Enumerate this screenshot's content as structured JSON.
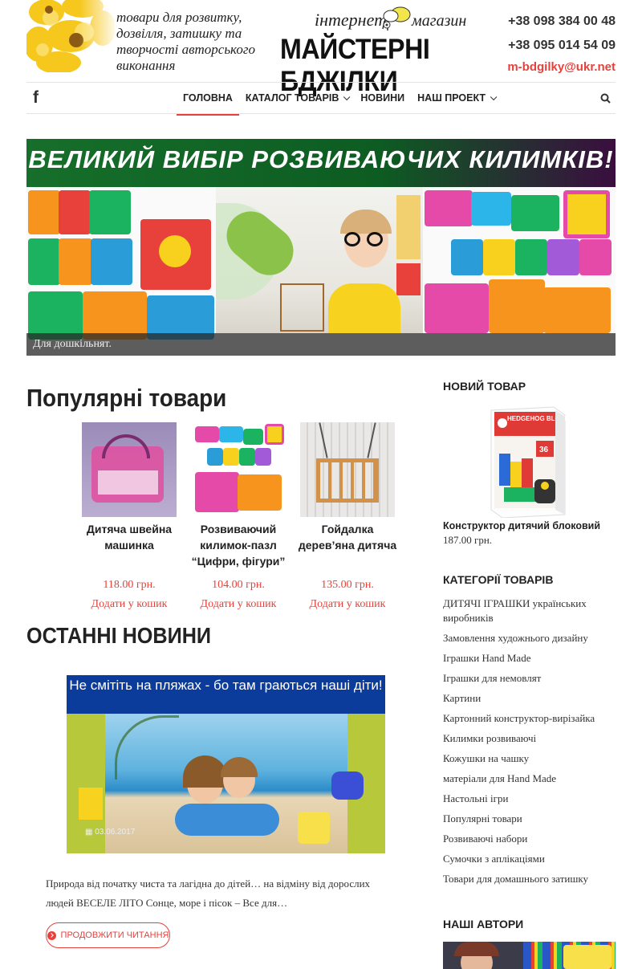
{
  "header": {
    "tagline": "товари для розвитку, дозвілля, затишку та творчості авторського виконання",
    "logo_word1": "інтернет",
    "logo_word2": "магазин",
    "logo_name": "МАЙСТЕРНІ БДЖІЛКИ",
    "phone1": "+38 098 384 00 48",
    "phone2": "+38 095 014 54 09",
    "email": "m-bdgilky@ukr.net"
  },
  "nav": {
    "items": [
      {
        "label": "ГОЛОВНА",
        "active": true
      },
      {
        "label": "КАТАЛОГ ТОВАРІВ",
        "has_dropdown": true
      },
      {
        "label": "НОВИНИ"
      },
      {
        "label": "НАШ ПРОЕКТ",
        "has_dropdown": true
      }
    ],
    "social_icon": "facebook-icon",
    "search_icon": "search-icon"
  },
  "banner": {
    "title": "ВЕЛИКИЙ ВИБІР РОЗВИВАЮЧИХ КИЛИМКІВ!",
    "caption": "Для дошкільнят."
  },
  "popular": {
    "title": "Популярні товари",
    "products": [
      {
        "name": "Дитяча швейна машинка",
        "price": "118.00 грн.",
        "cart": "Додати у кошик"
      },
      {
        "name": "Розвиваючий килимок-пазл “Цифри, фігури”",
        "price": "104.00 грн.",
        "cart": "Додати у кошик"
      },
      {
        "name": "Гойдалка дерев’яна дитяча",
        "price": "135.00 грн.",
        "cart": "Додати у кошик"
      }
    ]
  },
  "news": {
    "title": "ОСТАННІ НОВИНИ",
    "image_headline": "Не смітіть на пляжах - бо там граються наші діти!",
    "date": "03.06.2017",
    "excerpt": "Природа від початку чиста та лагідна до дітей… на відміну від дорослих людей ВЕСЕЛЕ ЛІТО Сонце, море і пісок – Все для…",
    "read_more": "ПРОДОВЖИТИ ЧИТАННЯ"
  },
  "sidebar": {
    "new_product_title": "НОВИЙ ТОВАР",
    "new_product_name": "Конструктор дитячий блоковий",
    "new_product_price": "187.00 грн.",
    "new_product_box_text": "HEDGEHOG BLOCKS",
    "new_product_box_count": "36",
    "categories_title": "КАТЕГОРІЇ ТОВАРІВ",
    "categories": [
      "ДИТЯЧІ ІГРАШКИ українських виробників",
      "Замовлення художнього дизайну",
      "Іграшки Hand Made",
      "Іграшки для немовлят",
      "Картини",
      "Картонний конструктор-вирізайка",
      "Килимки розвиваючі",
      "Кожушки на чашку",
      "матеріали для Hand Made",
      "Настольні ігри",
      "Популярні товари",
      "Розвиваючі набори",
      "Сумочки з аплікаціями",
      "Товари для домашнього затишку"
    ],
    "authors_title": "НАШІ АВТОРИ"
  },
  "colors": {
    "accent": "#e8413b",
    "banner_green": "#0d5c22",
    "news_blue": "#0b3c9c"
  }
}
